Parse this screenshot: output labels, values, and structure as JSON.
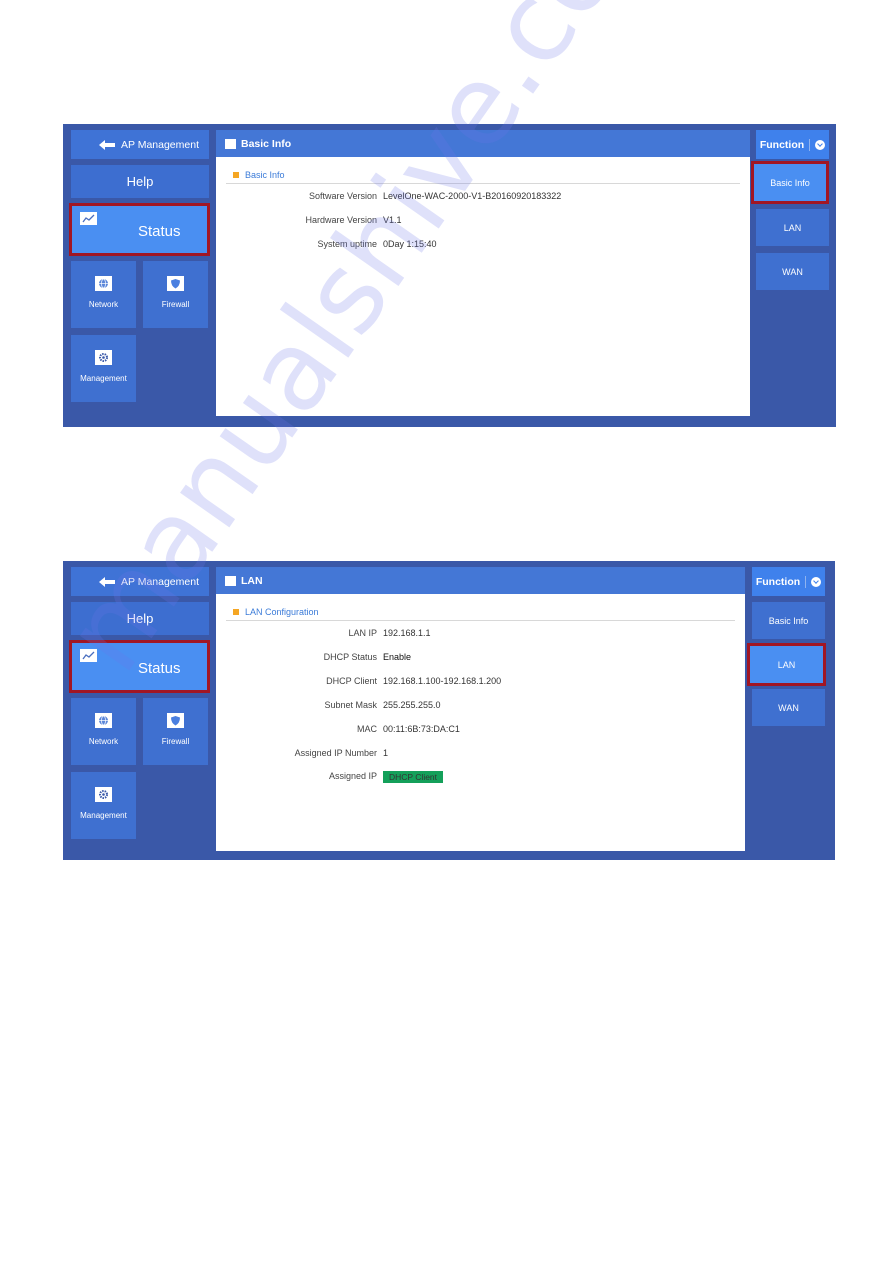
{
  "screens": [
    {
      "nav": {
        "ap_management": "AP Management",
        "help": "Help",
        "status": "Status",
        "network": "Network",
        "firewall": "Firewall",
        "management": "Management"
      },
      "header": {
        "title": "Basic Info"
      },
      "section": {
        "title": "Basic Info"
      },
      "rows": [
        {
          "label": "Software Version",
          "value": "LevelOne-WAC-2000-V1-B20160920183322"
        },
        {
          "label": "Hardware Version",
          "value": "V1.1"
        },
        {
          "label": "System uptime",
          "value": "0Day 1:15:40"
        }
      ],
      "function": {
        "title": "Function",
        "items": [
          "Basic Info",
          "LAN",
          "WAN"
        ],
        "active": "Basic Info"
      }
    },
    {
      "nav": {
        "ap_management": "AP Management",
        "help": "Help",
        "status": "Status",
        "network": "Network",
        "firewall": "Firewall",
        "management": "Management"
      },
      "header": {
        "title": "LAN"
      },
      "section": {
        "title": "LAN Configuration"
      },
      "rows": [
        {
          "label": "LAN IP",
          "value": "192.168.1.1"
        },
        {
          "label": "DHCP Status",
          "value": "Enable"
        },
        {
          "label": "DHCP Client",
          "value": "192.168.1.100-192.168.1.200"
        },
        {
          "label": "Subnet Mask",
          "value": "255.255.255.0"
        },
        {
          "label": "MAC",
          "value": "00:11:6B:73:DA:C1"
        },
        {
          "label": "Assigned IP Number",
          "value": "1"
        },
        {
          "label": "Assigned IP",
          "value": "DHCP Client"
        }
      ],
      "function": {
        "title": "Function",
        "items": [
          "Basic Info",
          "LAN",
          "WAN"
        ],
        "active": "LAN"
      }
    }
  ],
  "watermark": "manualshive.com",
  "colors": {
    "frame": "#3a58a8",
    "tile": "#3f70d0",
    "active_tile": "#4a8ff2",
    "highlight_border": "#a11624",
    "section_accent": "#f5a623",
    "badge": "#14a05a"
  }
}
